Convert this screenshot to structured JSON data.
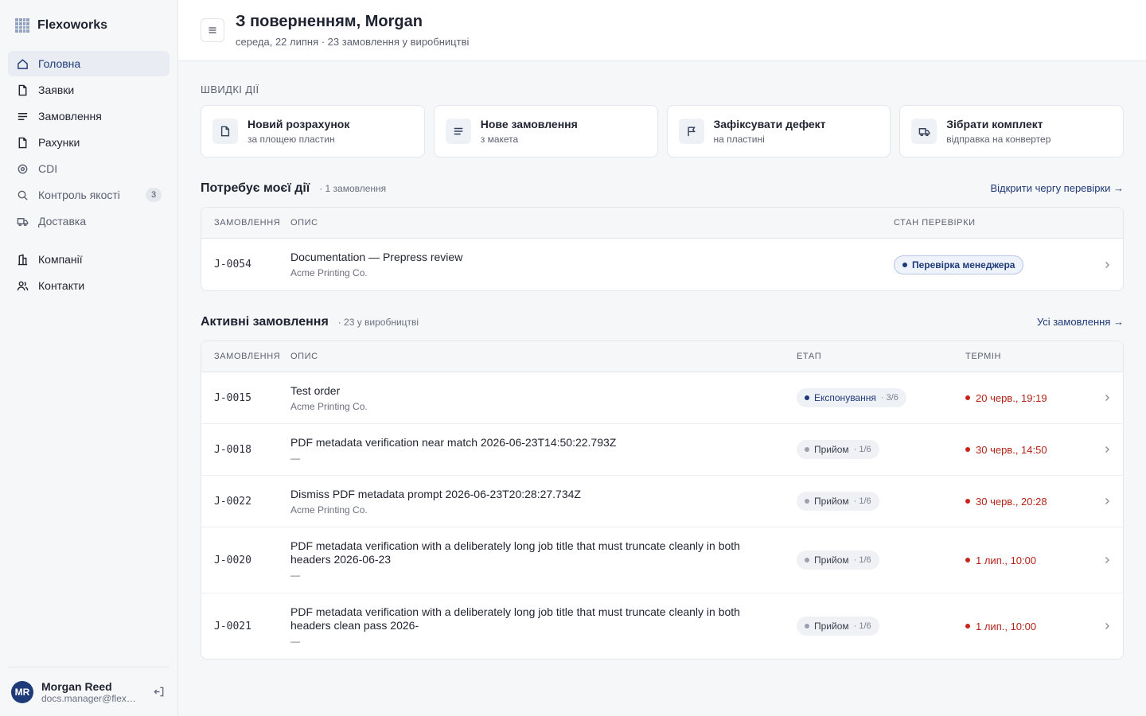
{
  "sidebar": {
    "brand": "Flexoworks",
    "nav": [
      {
        "label": "Головна",
        "icon": "home-icon"
      },
      {
        "label": "Заявки",
        "icon": "document-icon"
      },
      {
        "label": "Замовлення",
        "icon": "list-icon"
      },
      {
        "label": "Рахунки",
        "icon": "receipt-icon"
      },
      {
        "label": "CDI",
        "icon": "target-icon"
      },
      {
        "label": "Контроль якості",
        "icon": "search-icon",
        "badge": "3"
      },
      {
        "label": "Доставка",
        "icon": "truck-icon"
      }
    ],
    "nav2": [
      {
        "label": "Компанії",
        "icon": "building-icon"
      },
      {
        "label": "Контакти",
        "icon": "users-icon"
      }
    ],
    "user": {
      "initials": "MR",
      "name": "Morgan Reed",
      "email": "docs.manager@flexoworks.com"
    }
  },
  "header": {
    "title": "З поверненням, Morgan",
    "subtitle": "середа, 22 липня · 23 замовлення у виробництві"
  },
  "quick": {
    "label": "Швидкі дії",
    "actions": [
      {
        "title": "Новий розрахунок",
        "sub": "за площею пластин",
        "icon": "file-icon"
      },
      {
        "title": "Нове замовлення",
        "sub": "з макета",
        "icon": "lines-icon"
      },
      {
        "title": "Зафіксувати дефект",
        "sub": "на пластині",
        "icon": "flag-icon"
      },
      {
        "title": "Зібрати комплект",
        "sub": "відправка на конвертер",
        "icon": "truck-icon"
      }
    ]
  },
  "action_needed": {
    "title": "Потребує моєї дії",
    "count": "· 1 замовлення",
    "link": "Відкрити чергу перевірки →",
    "columns": [
      "Замовлення",
      "Опис",
      "Стан перевірки"
    ],
    "rows": [
      {
        "id": "J-0054",
        "title": "Documentation — Prepress review",
        "sub": "Acme Printing Co.",
        "status": "Перевірка менеджера"
      }
    ]
  },
  "active": {
    "title": "Активні замовлення",
    "count": "· 23 у виробництві",
    "link": "Усі замовлення →",
    "columns": [
      "Замовлення",
      "Опис",
      "Етап",
      "Термін"
    ],
    "rows": [
      {
        "id": "J-0015",
        "title": "Test order",
        "sub": "Acme Printing Co.",
        "stage": "Експонування",
        "frac": "· 3/6",
        "due": "20 черв., 19:19",
        "active": true
      },
      {
        "id": "J-0018",
        "title": "PDF metadata verification near match 2026-06-23T14:50:22.793Z",
        "sub": "—",
        "stage": "Прийом",
        "frac": "· 1/6",
        "due": "30 черв., 14:50"
      },
      {
        "id": "J-0022",
        "title": "Dismiss PDF metadata prompt 2026-06-23T20:28:27.734Z",
        "sub": "Acme Printing Co.",
        "stage": "Прийом",
        "frac": "· 1/6",
        "due": "30 черв., 20:28"
      },
      {
        "id": "J-0020",
        "title": "PDF metadata verification with a deliberately long job title that must truncate cleanly in both headers 2026-06-23",
        "sub": "—",
        "stage": "Прийом",
        "frac": "· 1/6",
        "due": "1 лип., 10:00"
      },
      {
        "id": "J-0021",
        "title": "PDF metadata verification with a deliberately long job title that must truncate cleanly in both headers clean pass 2026-",
        "sub": "—",
        "stage": "Прийом",
        "frac": "· 1/6",
        "due": "1 лип., 10:00"
      }
    ]
  }
}
